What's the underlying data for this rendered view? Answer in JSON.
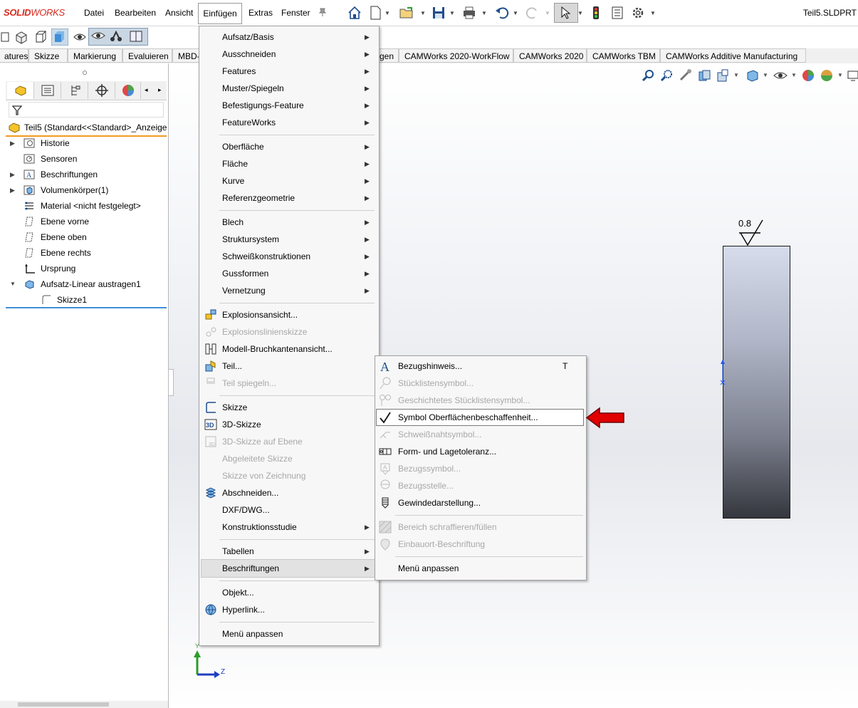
{
  "app": {
    "logo": "SOLIDWORKS",
    "filename": "Teil5.SLDPRT"
  },
  "menubar": {
    "items": [
      "Datei",
      "Bearbeiten",
      "Ansicht",
      "Einfügen",
      "Extras",
      "Fenster"
    ]
  },
  "ribbon_tabs": [
    "atures",
    "Skizze",
    "Markierung",
    "Evaluieren",
    "MBD-",
    "gen",
    "CAMWorks 2020-WorkFlow",
    "CAMWorks 2020",
    "CAMWorks TBM",
    "CAMWorks Additive Manufacturing"
  ],
  "tree": {
    "root": "Teil5  (Standard<<Standard>_Anzeige",
    "items": [
      {
        "label": "Historie",
        "expandable": true
      },
      {
        "label": "Sensoren",
        "expandable": false
      },
      {
        "label": "Beschriftungen",
        "expandable": true
      },
      {
        "label": "Volumenkörper(1)",
        "expandable": true
      },
      {
        "label": "Material <nicht festgelegt>",
        "expandable": false
      },
      {
        "label": "Ebene vorne",
        "expandable": false
      },
      {
        "label": "Ebene oben",
        "expandable": false
      },
      {
        "label": "Ebene rechts",
        "expandable": false
      },
      {
        "label": "Ursprung",
        "expandable": false
      },
      {
        "label": "Aufsatz-Linear austragen1",
        "expandable": true
      },
      {
        "label": "Skizze1",
        "expandable": false
      }
    ]
  },
  "main_menu": {
    "items": [
      {
        "label": "Aufsatz/Basis",
        "sub": true,
        "disabled": false
      },
      {
        "label": "Ausschneiden",
        "sub": true,
        "disabled": false
      },
      {
        "label": "Features",
        "sub": true,
        "disabled": false
      },
      {
        "label": "Muster/Spiegeln",
        "sub": true,
        "disabled": false
      },
      {
        "label": "Befestigungs-Feature",
        "sub": true,
        "disabled": false
      },
      {
        "label": "FeatureWorks",
        "sub": true,
        "disabled": false
      },
      {
        "label": "Oberfläche",
        "sub": true,
        "disabled": false
      },
      {
        "label": "Fläche",
        "sub": true,
        "disabled": false
      },
      {
        "label": "Kurve",
        "sub": true,
        "disabled": false
      },
      {
        "label": "Referenzgeometrie",
        "sub": true,
        "disabled": false
      },
      {
        "label": "Blech",
        "sub": true,
        "disabled": false
      },
      {
        "label": "Struktursystem",
        "sub": true,
        "disabled": false
      },
      {
        "label": "Schweißkonstruktionen",
        "sub": true,
        "disabled": false
      },
      {
        "label": "Gussformen",
        "sub": true,
        "disabled": false
      },
      {
        "label": "Vernetzung",
        "sub": true,
        "disabled": false
      },
      {
        "label": "Explosionsansicht...",
        "sub": false,
        "disabled": false
      },
      {
        "label": "Explosionslinienskizze",
        "sub": false,
        "disabled": true
      },
      {
        "label": "Modell-Bruchkantenansicht...",
        "sub": false,
        "disabled": false
      },
      {
        "label": "Teil...",
        "sub": false,
        "disabled": false
      },
      {
        "label": "Teil spiegeln...",
        "sub": false,
        "disabled": true
      },
      {
        "label": "Skizze",
        "sub": false,
        "disabled": false
      },
      {
        "label": "3D-Skizze",
        "sub": false,
        "disabled": false
      },
      {
        "label": "3D-Skizze auf Ebene",
        "sub": false,
        "disabled": true
      },
      {
        "label": "Abgeleitete Skizze",
        "sub": false,
        "disabled": true
      },
      {
        "label": "Skizze von Zeichnung",
        "sub": false,
        "disabled": true
      },
      {
        "label": "Abschneiden...",
        "sub": false,
        "disabled": false
      },
      {
        "label": "DXF/DWG...",
        "sub": false,
        "disabled": false
      },
      {
        "label": "Konstruktionsstudie",
        "sub": true,
        "disabled": false
      },
      {
        "label": "Tabellen",
        "sub": true,
        "disabled": false
      },
      {
        "label": "Beschriftungen",
        "sub": true,
        "disabled": false,
        "highlighted": true
      },
      {
        "label": "Objekt...",
        "sub": false,
        "disabled": false
      },
      {
        "label": "Hyperlink...",
        "sub": false,
        "disabled": false
      },
      {
        "label": "Menü anpassen",
        "sub": false,
        "disabled": false
      }
    ]
  },
  "sub_menu": {
    "items": [
      {
        "label": "Bezugshinweis...",
        "shortcut": "T",
        "disabled": false
      },
      {
        "label": "Stücklistensymbol...",
        "disabled": true
      },
      {
        "label": "Geschichtetes Stücklistensymbol...",
        "disabled": true
      },
      {
        "label": "Symbol Oberflächenbeschaffenheit...",
        "disabled": false,
        "highlighted": true
      },
      {
        "label": "Schweißnahtsymbol...",
        "disabled": true
      },
      {
        "label": "Form- und Lagetoleranz...",
        "disabled": false
      },
      {
        "label": "Bezugssymbol...",
        "disabled": true
      },
      {
        "label": "Bezugsstelle...",
        "disabled": true
      },
      {
        "label": "Gewindedarstellung...",
        "disabled": false
      },
      {
        "label": "Bereich schraffieren/füllen",
        "disabled": true
      },
      {
        "label": "Einbauort-Beschriftung",
        "disabled": true
      },
      {
        "label": "Menü anpassen",
        "disabled": false
      }
    ]
  },
  "viewport": {
    "roughness_value": "0.8",
    "axis_y": "Y",
    "axis_z": "Z"
  },
  "colors": {
    "accent_red": "#d52b1e",
    "highlight_arrow": "#e00000",
    "tree_root_line": "#f29a1f",
    "tree_end_line": "#3f8fd8"
  }
}
